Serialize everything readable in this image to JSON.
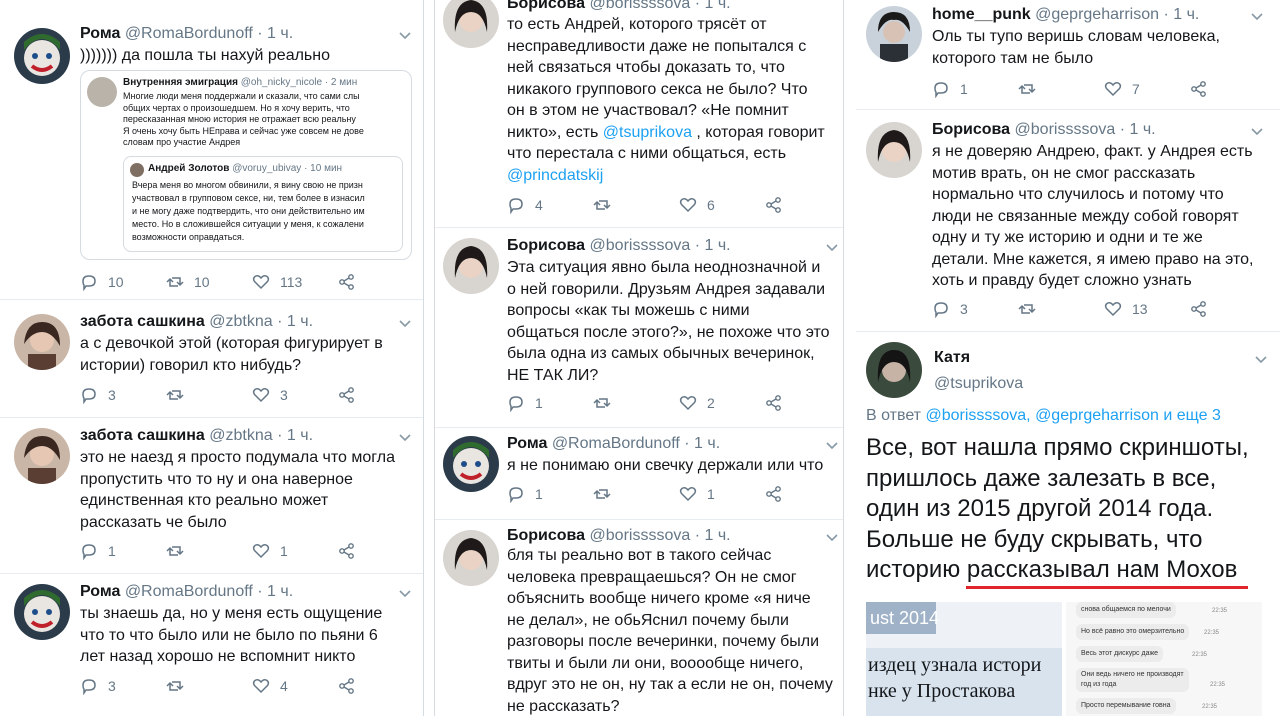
{
  "columns": [
    {
      "tweets": [
        {
          "name": "Рома",
          "handle": "@RomaBordunoff",
          "time": "· 1 ч.",
          "text": "))))))) да пошла ты нахуй реально",
          "counts": {
            "reply": "10",
            "retweet": "10",
            "like": "113"
          },
          "quote": {
            "header_name": "Внутренняя эмиграция",
            "header_handle": "@oh_nicky_nicole · 2 мин",
            "text": "Многие люди меня поддержали и сказали, что сами слы\nобщих чертах о произошедшем. Но я хочу верить, что\nпересказанная мною история не отражает всю реальну\nЯ очень хочу быть НЕправа и сейчас уже совсем не дове\nсловам про участие Андрея",
            "inner_name": "Андрей Золотов",
            "inner_handle": "@voruy_ubivay · 10 мин",
            "inner_text": "Вчера меня во многом обвинили, я вину свою не призн\nучаствовал в групповом сексе, ни, тем более в изнасил\nи не могу даже подтвердить, что они действительно им\nместо. Но в сложившейся ситуации у меня, к сожалени\nвозможности оправдаться."
          }
        },
        {
          "name": "забота сашкина",
          "handle": "@zbtkna",
          "time": "· 1 ч.",
          "text": "а с девочкой этой (которая фигурирует в\nистории) говорил кто нибудь?",
          "counts": {
            "reply": "3",
            "retweet": "",
            "like": "3"
          }
        },
        {
          "name": "забота сашкина",
          "handle": "@zbtkna",
          "time": "· 1 ч.",
          "text": "это не наезд я просто подумала что могла\nпропустить что то ну и она наверное\nединственная кто реально может\nрассказать че было",
          "counts": {
            "reply": "1",
            "retweet": "",
            "like": "1"
          }
        },
        {
          "name": "Рома",
          "handle": "@RomaBordunoff",
          "time": "· 1 ч.",
          "text": "ты знаешь да, но у меня есть ощущение\nчто то что было или не было по пьяни 6\nлет назад хорошо не вспомнит никто",
          "counts": {
            "reply": "3",
            "retweet": "",
            "like": "4"
          }
        }
      ]
    },
    {
      "tweets": [
        {
          "name": "Борисова",
          "handle": "@borissssova",
          "time": "· 1 ч.",
          "text_parts": [
            "то есть Андрей, которого трясёт от\nнесправедливости даже не попытался с\nней связаться чтобы доказать то, что\nникакого группового секса не было? Что\nон в этом не участвовал? «Не помнит\nникто», есть ",
            "@tsuprikova",
            " , которая говорит\nчто перестала с ними общаться, есть\n",
            "@princdatskij",
            ""
          ],
          "counts": {
            "reply": "4",
            "retweet": "",
            "like": "6"
          }
        },
        {
          "name": "Борисова",
          "handle": "@borissssova",
          "time": "· 1 ч.",
          "text": "Эта ситуация явно была неоднозначной и\nо ней говорили. Друзьям Андрея задавали\nвопросы «как ты можешь с ними\nобщаться после этого?», не похоже что это\nбыла одна из самых обычных вечеринок,\nНЕ ТАК ЛИ?",
          "counts": {
            "reply": "1",
            "retweet": "",
            "like": "2"
          }
        },
        {
          "name": "Рома",
          "handle": "@RomaBordunoff",
          "time": "· 1 ч.",
          "text": "я не понимаю они свечку держали или что",
          "counts": {
            "reply": "1",
            "retweet": "",
            "like": "1"
          }
        },
        {
          "name": "Борисова",
          "handle": "@borissssova",
          "time": "· 1 ч.",
          "text": "бля ты реально вот в такого сейчас\nчеловека превращаешься? Он не смог\nобъяснить вообще ничего кроме «я ниче\nне делал», не обьЯснил почему были\nразговоры после вечеринки, почему были\nтвиты и были ли они, вооообще ничего,\nвдруг это не он, ну так а если не он, почему\nне рассказать?"
        }
      ]
    },
    {
      "tweets": [
        {
          "name": "home__punk",
          "handle": "@geprgeharrison",
          "time": "· 1 ч.",
          "text": "Оль ты тупо веришь словам человека,\nкоторого там не было",
          "counts": {
            "reply": "1",
            "retweet": "",
            "like": "7"
          }
        },
        {
          "name": "Борисова",
          "handle": "@borissssova",
          "time": "· 1 ч.",
          "text": "я не доверяю Андрею, факт. у Андрея есть\nмотив врать, он не смог рассказать\nнормально что случилось и потому что\nлюди не связанные между собой говорят\nодну и ту же историю и одни и те же\nдетали. Мне кажется, я имею право на это,\nхоть и правду будет сложно узнать",
          "counts": {
            "reply": "3",
            "retweet": "",
            "like": "13"
          }
        }
      ],
      "main": {
        "name": "Катя",
        "handle": "@tsuprikova",
        "reply_prefix": "В ответ ",
        "reply_links": "@borissssova, @geprgeharrison и еще 3",
        "text": "Все, вот нашла прямо скриншоты,\nпришлось даже залезать в все,\nодин из 2015 другой 2014 года.\nБольше не буду скрывать, что\nисторию рассказывал нам Мохов",
        "shot1_top": "ust 2014",
        "shot1_text": "издец узнала истори\nнке у Простакова",
        "shot2_msgs": [
          "снова общаемся по мелочи",
          "Но всё равно это омерзительно",
          "Весь этот дискурс даже",
          "Они ведь ничего не производят\nгод из года",
          "Просто перемывание говна"
        ],
        "shot2_times": [
          "22:35",
          "22:35",
          "22:35",
          "22:35",
          "22:35"
        ]
      }
    }
  ],
  "accent": "#1da1f2",
  "underline_color": "#e0242a"
}
